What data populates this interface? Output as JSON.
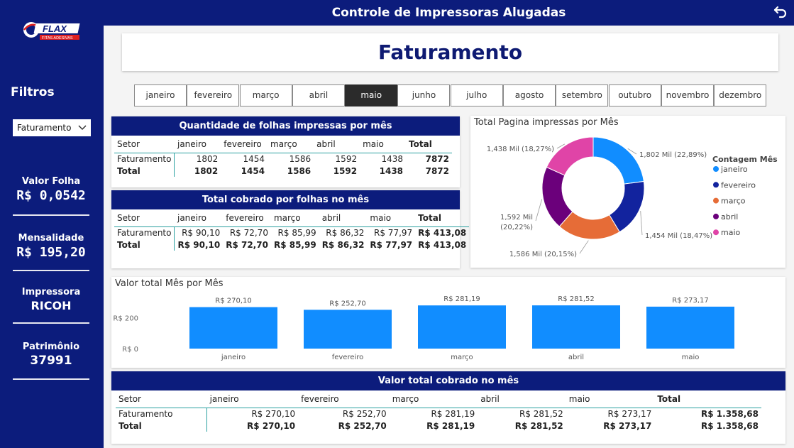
{
  "header": {
    "title": "Controle de Impressoras Alugadas",
    "back_icon": "back-arrow-icon"
  },
  "brand": {
    "logo_text": "FLAX",
    "logo_sub": "FITAS ADESIVAS"
  },
  "sidebar": {
    "filters_title": "Filtros",
    "filter_select_value": "Faturamento",
    "kpis": [
      {
        "label": "Valor Folha",
        "value": "R$ 0,0542"
      },
      {
        "label": "Mensalidade",
        "value": "R$ 195,20"
      },
      {
        "label": "Impressora",
        "value": "RICOH"
      },
      {
        "label": "Patrimônio",
        "value": "37991"
      }
    ]
  },
  "page_title": "Faturamento",
  "months": [
    "janeiro",
    "fevereiro",
    "março",
    "abril",
    "maio",
    "junho",
    "julho",
    "agosto",
    "setembro",
    "outubro",
    "novembro",
    "dezembro"
  ],
  "selected_month": "maio",
  "qty_table": {
    "title": "Quantidade de folhas impressas por mês",
    "columns": [
      "Setor",
      "janeiro",
      "fevereiro",
      "março",
      "abril",
      "maio",
      "Total"
    ],
    "rows": [
      [
        "Faturamento",
        "1802",
        "1454",
        "1586",
        "1592",
        "1438",
        "7872"
      ],
      [
        "Total",
        "1802",
        "1454",
        "1586",
        "1592",
        "1438",
        "7872"
      ]
    ]
  },
  "charged_table": {
    "title": "Total cobrado por folhas no mês",
    "columns": [
      "Setor",
      "janeiro",
      "fevereiro",
      "março",
      "abril",
      "maio",
      "Total"
    ],
    "rows": [
      [
        "Faturamento",
        "R$ 90,10",
        "R$ 72,70",
        "R$ 85,99",
        "R$ 86,32",
        "R$ 77,97",
        "R$ 413,08"
      ],
      [
        "Total",
        "R$ 90,10",
        "R$ 72,70",
        "R$ 85,99",
        "R$ 86,32",
        "R$ 77,97",
        "R$ 413,08"
      ]
    ]
  },
  "total_table": {
    "title": "Valor total cobrado no mês",
    "columns": [
      "Setor",
      "janeiro",
      "fevereiro",
      "março",
      "abril",
      "maio",
      "Total"
    ],
    "rows": [
      [
        "Faturamento",
        "R$ 270,10",
        "R$ 252,70",
        "R$ 281,19",
        "R$ 281,52",
        "R$ 273,17",
        "R$ 1.358,68"
      ],
      [
        "Total",
        "R$ 270,10",
        "R$ 252,70",
        "R$ 281,19",
        "R$ 281,52",
        "R$ 273,17",
        "R$ 1.358,68"
      ]
    ]
  },
  "chart_data": [
    {
      "type": "pie",
      "title": "Total Pagina impressas por Mês",
      "legend_title": "Contagem Mês",
      "legend_position": "right",
      "categories": [
        "janeiro",
        "fevereiro",
        "março",
        "abril",
        "maio"
      ],
      "values": [
        1802,
        1454,
        1586,
        1592,
        1438
      ],
      "data_labels": [
        "1,802 Mil (22,89%)",
        "1,454 Mil (18,47%)",
        "1,586 Mil (20,15%)",
        "1,592 Mil (20,22%)",
        "1,438 Mil (18,27%)"
      ],
      "colors": [
        "#118dff",
        "#12239e",
        "#e66c37",
        "#6b007b",
        "#e044a7"
      ]
    },
    {
      "type": "bar",
      "title": "Valor total Mês por Mês",
      "categories": [
        "janeiro",
        "fevereiro",
        "março",
        "abril",
        "maio"
      ],
      "values": [
        270.1,
        252.7,
        281.19,
        281.52,
        273.17
      ],
      "data_labels": [
        "R$ 270,10",
        "R$ 252,70",
        "R$ 281,19",
        "R$ 281,52",
        "R$ 273,17"
      ],
      "y_ticks": [
        "R$ 0",
        "R$ 200"
      ],
      "ylim": [
        0,
        282
      ],
      "grid": false,
      "color": "#118dff"
    }
  ]
}
